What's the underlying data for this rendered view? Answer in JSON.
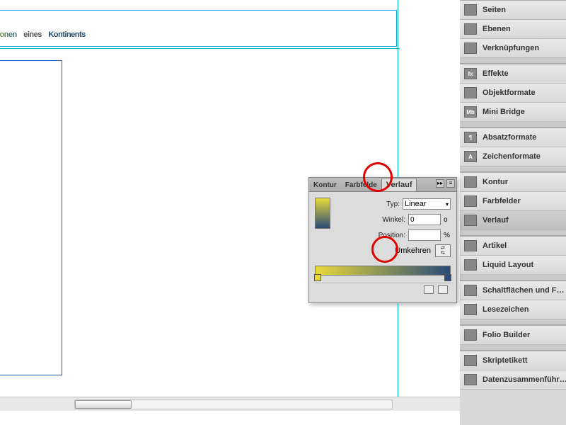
{
  "document": {
    "headline_word1": "essionen",
    "headline_word2": "eines",
    "headline_word3": "Kontinents"
  },
  "panels": {
    "group1": [
      {
        "label": "Seiten",
        "icon": "⧉"
      },
      {
        "label": "Ebenen",
        "icon": "≣"
      },
      {
        "label": "Verknüpfungen",
        "icon": "⚭"
      }
    ],
    "group2": [
      {
        "label": "Effekte",
        "icon": "fx"
      },
      {
        "label": "Objektformate",
        "icon": "◧"
      },
      {
        "label": "Mini Bridge",
        "icon": "Mb"
      }
    ],
    "group3": [
      {
        "label": "Absatzformate",
        "icon": "¶"
      },
      {
        "label": "Zeichenformate",
        "icon": "A"
      }
    ],
    "group4": [
      {
        "label": "Kontur",
        "icon": "≡"
      },
      {
        "label": "Farbfelder",
        "icon": "▦"
      },
      {
        "label": "Verlauf",
        "icon": "▭"
      }
    ],
    "group5": [
      {
        "label": "Artikel",
        "icon": "☰"
      },
      {
        "label": "Liquid Layout",
        "icon": "⬚"
      }
    ],
    "group6": [
      {
        "label": "Schaltflächen und F…",
        "icon": "◪"
      },
      {
        "label": "Lesezeichen",
        "icon": "⊕"
      }
    ],
    "group7": [
      {
        "label": "Folio Builder",
        "icon": "❐"
      }
    ],
    "group8": [
      {
        "label": "Skriptetikett",
        "icon": "✎"
      },
      {
        "label": "Datenzusammenführ…",
        "icon": "⇄"
      }
    ]
  },
  "gradient_panel": {
    "tabs": {
      "kontur": "Kontur",
      "farbfelder": "Farbfelde",
      "verlauf": "Verlauf"
    },
    "typ_label": "Typ:",
    "typ_value": "Linear",
    "winkel_label": "Winkel:",
    "winkel_value": "0",
    "winkel_unit": "o",
    "position_label": "Position:",
    "position_value": "",
    "position_unit": "%",
    "umkehren_label": "Umkehren"
  }
}
